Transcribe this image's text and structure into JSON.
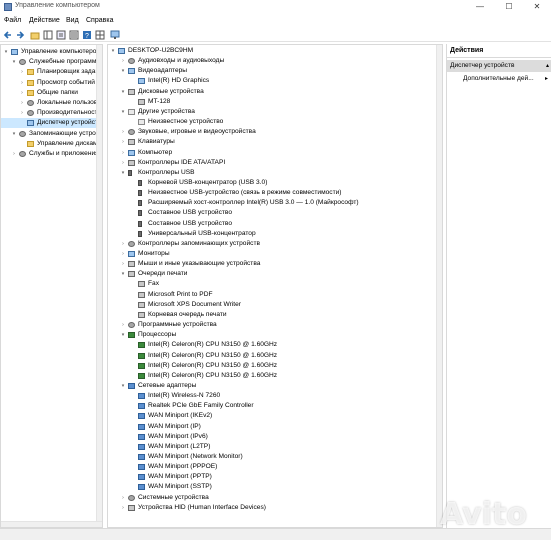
{
  "window": {
    "title": "Управление компьютером",
    "minimize": "—",
    "maximize": "☐",
    "close": "✕"
  },
  "menu": [
    "Файл",
    "Действие",
    "Вид",
    "Справка"
  ],
  "left_tree": [
    {
      "label": "Управление компьютером (л",
      "level": 0,
      "expander": "▾",
      "icon": "pc"
    },
    {
      "label": "Служебные программы",
      "level": 1,
      "expander": "▾",
      "icon": "gear"
    },
    {
      "label": "Планировщик заданий",
      "level": 2,
      "expander": "›",
      "icon": "folder"
    },
    {
      "label": "Просмотр событий",
      "level": 2,
      "expander": "›",
      "icon": "folder"
    },
    {
      "label": "Общие папки",
      "level": 2,
      "expander": "›",
      "icon": "folder"
    },
    {
      "label": "Локальные пользовате",
      "level": 2,
      "expander": "›",
      "icon": "gear"
    },
    {
      "label": "Производительность",
      "level": 2,
      "expander": "›",
      "icon": "gear"
    },
    {
      "label": "Диспетчер устройств",
      "level": 2,
      "expander": "",
      "icon": "pc",
      "selected": true
    },
    {
      "label": "Запоминающие устройств",
      "level": 1,
      "expander": "▾",
      "icon": "gear"
    },
    {
      "label": "Управление дисками",
      "level": 2,
      "expander": "",
      "icon": "folder"
    },
    {
      "label": "Службы и приложения",
      "level": 1,
      "expander": "›",
      "icon": "gear"
    }
  ],
  "device_tree": [
    {
      "label": "DESKTOP-U2BC9HM",
      "level": 0,
      "expander": "▾",
      "icon": "pc"
    },
    {
      "label": "Аудиовходы и аудиовыходы",
      "level": 1,
      "expander": "›",
      "icon": "gear"
    },
    {
      "label": "Видеоадаптеры",
      "level": 1,
      "expander": "▾",
      "icon": "pc"
    },
    {
      "label": "Intel(R) HD Graphics",
      "level": 2,
      "expander": "",
      "icon": "pc"
    },
    {
      "label": "Дисковые устройства",
      "level": 1,
      "expander": "▾",
      "icon": "print"
    },
    {
      "label": "MT-128",
      "level": 2,
      "expander": "",
      "icon": "print"
    },
    {
      "label": "Другие устройства",
      "level": 1,
      "expander": "▾",
      "icon": "warn"
    },
    {
      "label": "Неизвестное устройство",
      "level": 2,
      "expander": "",
      "icon": "warn"
    },
    {
      "label": "Звуковые, игровые и видеоустройства",
      "level": 1,
      "expander": "›",
      "icon": "gear"
    },
    {
      "label": "Клавиатуры",
      "level": 1,
      "expander": "›",
      "icon": "print"
    },
    {
      "label": "Компьютер",
      "level": 1,
      "expander": "›",
      "icon": "pc"
    },
    {
      "label": "Контроллеры IDE ATA/ATAPI",
      "level": 1,
      "expander": "›",
      "icon": "print"
    },
    {
      "label": "Контроллеры USB",
      "level": 1,
      "expander": "▾",
      "icon": "usb"
    },
    {
      "label": "Корневой USB-концентратор (USB 3.0)",
      "level": 2,
      "expander": "",
      "icon": "usb"
    },
    {
      "label": "Неизвестное USB-устройство (связь в режиме совместимости)",
      "level": 2,
      "expander": "",
      "icon": "usb"
    },
    {
      "label": "Расширяемый хост-контроллер Intel(R) USB 3.0 — 1.0 (Майкрософт)",
      "level": 2,
      "expander": "",
      "icon": "usb"
    },
    {
      "label": "Составное USB устройство",
      "level": 2,
      "expander": "",
      "icon": "usb"
    },
    {
      "label": "Составное USB устройство",
      "level": 2,
      "expander": "",
      "icon": "usb"
    },
    {
      "label": "Универсальный USB-концентратор",
      "level": 2,
      "expander": "",
      "icon": "usb"
    },
    {
      "label": "Контроллеры запоминающих устройств",
      "level": 1,
      "expander": "›",
      "icon": "gear"
    },
    {
      "label": "Мониторы",
      "level": 1,
      "expander": "›",
      "icon": "pc"
    },
    {
      "label": "Мыши и иные указывающие устройства",
      "level": 1,
      "expander": "›",
      "icon": "print"
    },
    {
      "label": "Очереди печати",
      "level": 1,
      "expander": "▾",
      "icon": "print"
    },
    {
      "label": "Fax",
      "level": 2,
      "expander": "",
      "icon": "print"
    },
    {
      "label": "Microsoft Print to PDF",
      "level": 2,
      "expander": "",
      "icon": "print"
    },
    {
      "label": "Microsoft XPS Document Writer",
      "level": 2,
      "expander": "",
      "icon": "print"
    },
    {
      "label": "Корневая очередь печати",
      "level": 2,
      "expander": "",
      "icon": "print"
    },
    {
      "label": "Программные устройства",
      "level": 1,
      "expander": "›",
      "icon": "gear"
    },
    {
      "label": "Процессоры",
      "level": 1,
      "expander": "▾",
      "icon": "cpu"
    },
    {
      "label": "Intel(R) Celeron(R) CPU  N3150  @ 1.60GHz",
      "level": 2,
      "expander": "",
      "icon": "cpu"
    },
    {
      "label": "Intel(R) Celeron(R) CPU  N3150  @ 1.60GHz",
      "level": 2,
      "expander": "",
      "icon": "cpu"
    },
    {
      "label": "Intel(R) Celeron(R) CPU  N3150  @ 1.60GHz",
      "level": 2,
      "expander": "",
      "icon": "cpu"
    },
    {
      "label": "Intel(R) Celeron(R) CPU  N3150  @ 1.60GHz",
      "level": 2,
      "expander": "",
      "icon": "cpu"
    },
    {
      "label": "Сетевые адаптеры",
      "level": 1,
      "expander": "▾",
      "icon": "net"
    },
    {
      "label": "Intel(R) Wireless-N 7260",
      "level": 2,
      "expander": "",
      "icon": "net"
    },
    {
      "label": "Realtek PCIe GbE Family Controller",
      "level": 2,
      "expander": "",
      "icon": "net"
    },
    {
      "label": "WAN Miniport (IKEv2)",
      "level": 2,
      "expander": "",
      "icon": "net"
    },
    {
      "label": "WAN Miniport (IP)",
      "level": 2,
      "expander": "",
      "icon": "net"
    },
    {
      "label": "WAN Miniport (IPv6)",
      "level": 2,
      "expander": "",
      "icon": "net"
    },
    {
      "label": "WAN Miniport (L2TP)",
      "level": 2,
      "expander": "",
      "icon": "net"
    },
    {
      "label": "WAN Miniport (Network Monitor)",
      "level": 2,
      "expander": "",
      "icon": "net"
    },
    {
      "label": "WAN Miniport (PPPOE)",
      "level": 2,
      "expander": "",
      "icon": "net"
    },
    {
      "label": "WAN Miniport (PPTP)",
      "level": 2,
      "expander": "",
      "icon": "net"
    },
    {
      "label": "WAN Miniport (SSTP)",
      "level": 2,
      "expander": "",
      "icon": "net"
    },
    {
      "label": "Системные устройства",
      "level": 1,
      "expander": "›",
      "icon": "gear"
    },
    {
      "label": "Устройства HID (Human Interface Devices)",
      "level": 1,
      "expander": "›",
      "icon": "print"
    }
  ],
  "actions": {
    "header": "Действия",
    "section": "Диспетчер устройств",
    "section_arrow": "▴",
    "item": "Дополнительные дей...",
    "item_arrow": "▸"
  },
  "watermark": "Avito"
}
